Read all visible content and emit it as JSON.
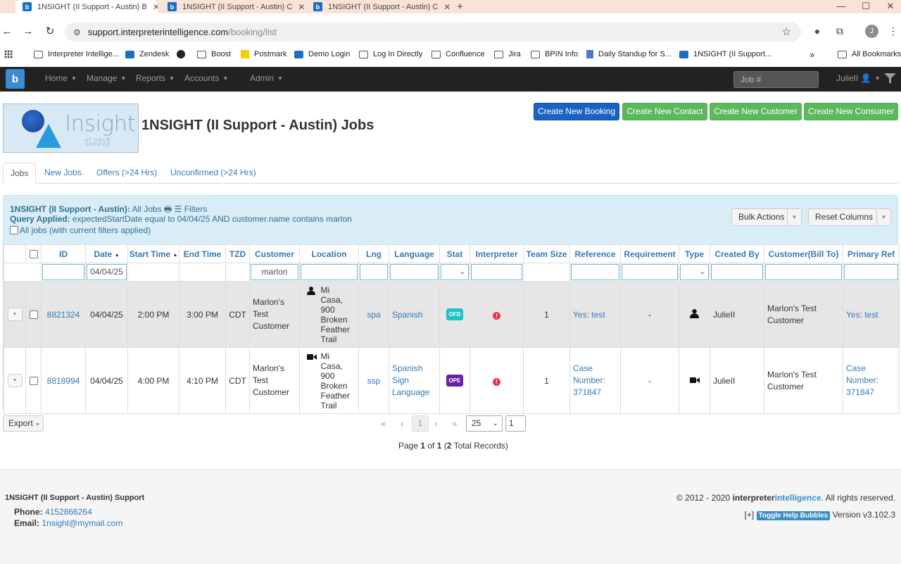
{
  "browser": {
    "tabs": [
      {
        "title": "1NSIGHT (II Support - Austin) B"
      },
      {
        "title": "1NSIGHT (II Support - Austin) C"
      },
      {
        "title": "1NSIGHT (II Support - Austin) C"
      }
    ],
    "url_domain": "support.interpreterintelligence.com",
    "url_path": "/booking/list",
    "profile_initial": "J",
    "bookmarks": [
      {
        "label": "Interpreter Intellige...",
        "icon": "folder"
      },
      {
        "label": "Zendesk",
        "icon": "b"
      },
      {
        "label": "",
        "icon": "globe"
      },
      {
        "label": "Boost",
        "icon": "folder"
      },
      {
        "label": "Postmark",
        "icon": "p"
      },
      {
        "label": "Demo Login",
        "icon": "b"
      },
      {
        "label": "Log In Directly",
        "icon": "folder"
      },
      {
        "label": "Confluence",
        "icon": "folder"
      },
      {
        "label": "Jira",
        "icon": "folder"
      },
      {
        "label": "BPIN Info",
        "icon": "folder"
      },
      {
        "label": "Daily Standup for S...",
        "icon": "doc"
      },
      {
        "label": "1NSIGHT (II Support...",
        "icon": "b"
      }
    ],
    "more_bookmarks": "»",
    "all_bookmarks": "All Bookmarks"
  },
  "navbar": {
    "items": [
      "Home",
      "Manage",
      "Reports",
      "Accounts",
      "Admin"
    ],
    "job_search_placeholder": "Job #",
    "user": "JulieII"
  },
  "header": {
    "brand_word": "Insight",
    "brand_tagline": "AT YOUR SERVICE",
    "title": "1NSIGHT (II Support - Austin) Jobs",
    "buttons": [
      "Create New Booking",
      "Create New Contact",
      "Create New Customer",
      "Create New Consumer"
    ]
  },
  "tabs": [
    "Jobs",
    "New Jobs",
    "Offers (>24 Hrs)",
    "Unconfirmed (>24 Hrs)"
  ],
  "query": {
    "company": "1NSIGHT (II Support - Austin):",
    "view": "All Jobs",
    "filters_label": "Filters",
    "applied_label": "Query Applied:",
    "applied_text": "expectedStartDate equal to 04/04/25 AND customer.name contains marlon",
    "all_jobs_label": "All jobs (with current filters applied)",
    "bulk_actions": "Bulk Actions",
    "reset_columns": "Reset Columns"
  },
  "table": {
    "columns": [
      "ID",
      "Date",
      "Start Time",
      "End Time",
      "TZD",
      "Customer",
      "Location",
      "Lng",
      "Language",
      "Stat",
      "Interpreter",
      "Team Size",
      "Reference",
      "Requirement",
      "Type",
      "Created By",
      "Customer(Bill To)",
      "Primary Ref"
    ],
    "filters": {
      "date": "04/04/25",
      "customer": "marlon"
    },
    "rows": [
      {
        "id": "8821324",
        "date": "04/04/25",
        "start": "2:00 PM",
        "end": "3:00 PM",
        "tzd": "CDT",
        "customer": "Marlon's Test Customer",
        "location": "Mi Casa, 900 Broken Feather Trail",
        "location_icon": "person-icon",
        "lng": "spa",
        "language": "Spanish",
        "stat": "OFD",
        "stat_color": "#1bc4c9",
        "team_size": "1",
        "reference": "Yes: test",
        "requirement": "-",
        "type_icon": "person-icon",
        "created_by": "JulieII",
        "bill_to": "Marlon's Test Customer",
        "primary_ref": "Yes: test"
      },
      {
        "id": "8818994",
        "date": "04/04/25",
        "start": "4:00 PM",
        "end": "4:10 PM",
        "tzd": "CDT",
        "customer": "Marlon's Test Customer",
        "location": "Mi Casa, 900 Broken Feather Trail",
        "location_icon": "video-icon",
        "lng": "ssp",
        "language": "Spanish Sign Language",
        "stat": "OPE",
        "stat_color": "#6a1fa8",
        "team_size": "1",
        "reference": "Case Number: 371847",
        "requirement": "-",
        "type_icon": "video-icon",
        "created_by": "JulieII",
        "bill_to": "Marlon's Test Customer",
        "primary_ref": "Case Number: 371847"
      }
    ]
  },
  "pager": {
    "export": "Export",
    "current_page": "1",
    "page_size": "25",
    "jump": "1",
    "info_prefix": "Page ",
    "page": "1",
    "of": " of ",
    "pages": "1",
    "open_paren": " (",
    "total": "2",
    "suffix": " Total Records)"
  },
  "footer": {
    "title": "1NSIGHT (II Support - Austin) Support",
    "phone_label": "Phone:",
    "phone": "4152866264",
    "email_label": "Email:",
    "email": "1nsight@mymail.com",
    "copyright_prefix": "© 2012 - 2020 ",
    "brand_a": "interpreter",
    "brand_b": "intelligence",
    "rights": ". All rights reserved.",
    "help_prefix": "[+]",
    "help_label": "Toggle Help Bubbles",
    "version": "Version v3.102.3"
  }
}
